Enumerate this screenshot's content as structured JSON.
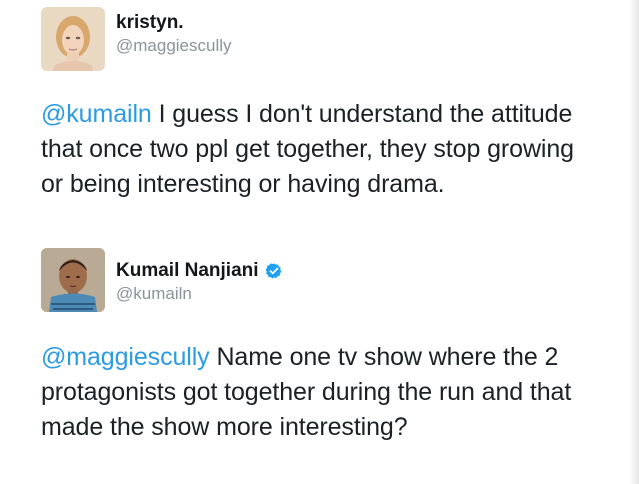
{
  "tweets": [
    {
      "user": {
        "display_name": "kristyn.",
        "handle": "@maggiescully",
        "verified": false,
        "avatar_icon": "portrait-avatar"
      },
      "mention": "@kumailn",
      "text": " I guess I don't understand the attitude that once two ppl get together, they stop growing or being interesting or having drama."
    },
    {
      "user": {
        "display_name": "Kumail Nanjiani",
        "handle": "@kumailn",
        "verified": true,
        "avatar_icon": "portrait-avatar",
        "badge_icon": "verified-check-icon"
      },
      "mention": "@maggiescully",
      "text": " Name one tv show where the 2 protagonists got together during the run and that made the show more interesting?"
    }
  ],
  "colors": {
    "mention": "#2b9be3",
    "handle": "#8a949c",
    "verified": "#1da1f2"
  }
}
